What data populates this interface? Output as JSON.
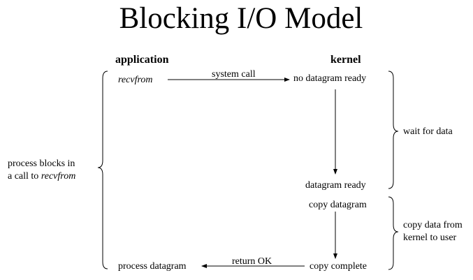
{
  "title": "Blocking I/O Model",
  "columns": {
    "application": "application",
    "kernel": "kernel"
  },
  "application": {
    "recvfrom": "recvfrom",
    "process_datagram": "process datagram"
  },
  "kernel": {
    "no_datagram_ready": "no datagram ready",
    "datagram_ready": "datagram ready",
    "copy_datagram": "copy datagram",
    "copy_complete": "copy complete"
  },
  "arrows": {
    "system_call": "system call",
    "return_ok": "return OK"
  },
  "left_brace_label": {
    "line1": "process blocks in",
    "line2_prefix": "a call to ",
    "line2_italic": "recvfrom"
  },
  "right_brace_labels": {
    "wait_for_data": "wait for data",
    "copy_data_line1": "copy data from",
    "copy_data_line2": "kernel to user"
  }
}
